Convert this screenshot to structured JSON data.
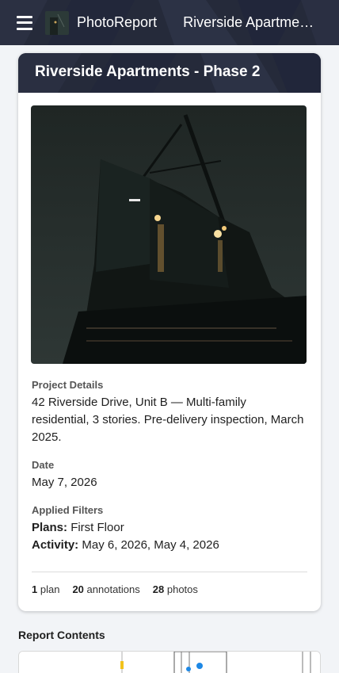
{
  "app": {
    "name": "PhotoReport",
    "header_title": "Riverside Apartments - Phase 2",
    "menu_icon": "hamburger-menu-icon",
    "logo_icon": "app-logo-thumbnail"
  },
  "report": {
    "title": "Riverside Apartments - Phase 2",
    "project_details_label": "Project Details",
    "project_details": "42 Riverside Drive, Unit B — Multi-family residential, 3 stories. Pre-delivery inspection, March 2025.",
    "date_label": "Date",
    "date": "May 7, 2026",
    "filters_label": "Applied Filters",
    "filters": {
      "plans_label": "Plans:",
      "plans_value": "First Floor",
      "activity_label": "Activity:",
      "activity_value": "May 6, 2026, May 4, 2026"
    },
    "stats": {
      "plans_count": "1",
      "plans_label": "plan",
      "annotations_count": "20",
      "annotations_label": "annotations",
      "photos_count": "28",
      "photos_label": "photos"
    }
  },
  "contents": {
    "label": "Report Contents"
  },
  "colors": {
    "header_bg": "#252a3a",
    "page_bg": "#f2f4f7"
  }
}
